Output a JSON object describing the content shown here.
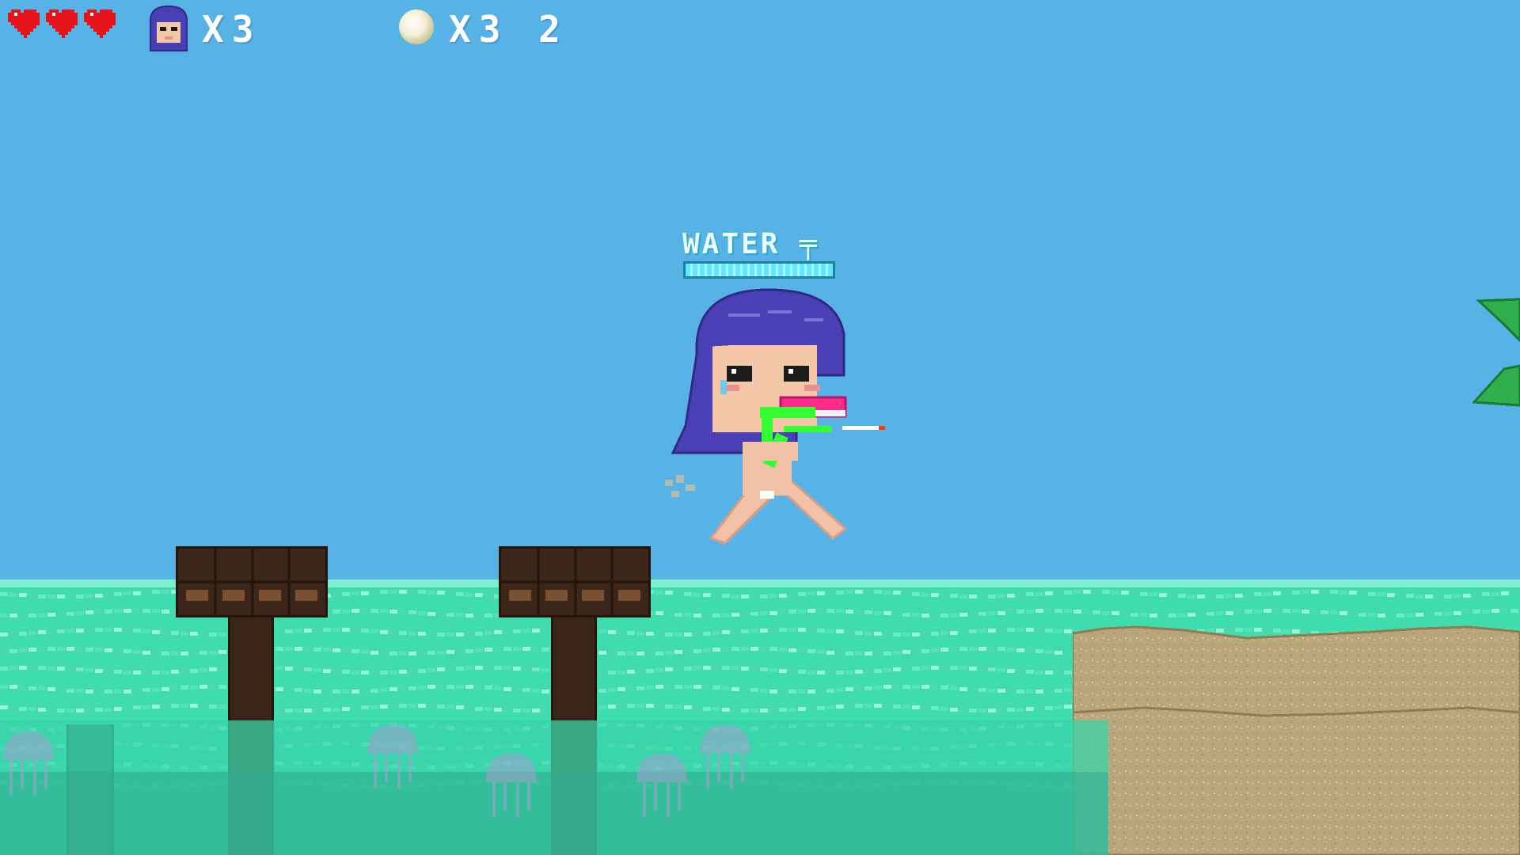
{
  "hud": {
    "hearts": 3,
    "lives_prefix": "X",
    "lives_count": "3",
    "pearls_prefix": "X",
    "pearls_count": "3 2"
  },
  "player": {
    "water_label": "WATER",
    "water_level": 1.0
  },
  "colors": {
    "sky": "#57b3e6",
    "sea": "#3fdcae",
    "heart": "#e4141a",
    "hair": "#4a3fb5",
    "sand": "#b9a67a",
    "post": "#3b2518"
  },
  "icons": {
    "heart": "heart-icon",
    "lives": "player-head-icon",
    "pearl": "pearl-icon",
    "gun": "water-gun-icon"
  }
}
